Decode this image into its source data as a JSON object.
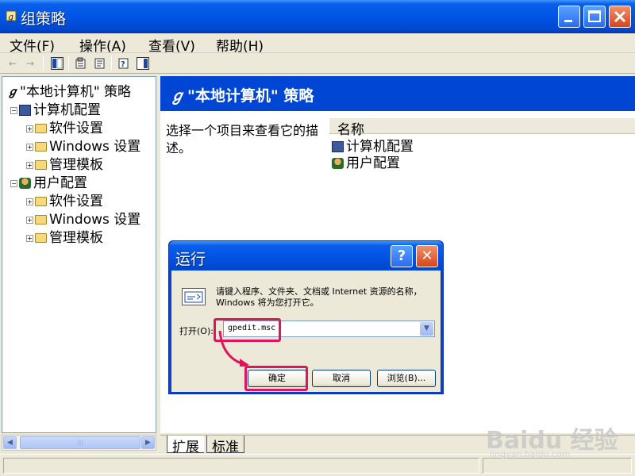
{
  "window": {
    "title": "组策略"
  },
  "menu": [
    "文件(F)",
    "操作(A)",
    "查看(V)",
    "帮助(H)"
  ],
  "toolbar": {
    "back": "←",
    "forward": "→"
  },
  "tree": {
    "root": "\"本地计算机\" 策略",
    "computer_config": "计算机配置",
    "user_config": "用户配置",
    "software_settings": "软件设置",
    "windows_settings": "Windows 设置",
    "admin_templates": "管理模板",
    "collapse_symbol": "−",
    "expand_symbol": "+"
  },
  "right_pane": {
    "header_title": "\"本地计算机\" 策略",
    "description": "选择一个项目来查看它的描述。",
    "column_name": "名称",
    "items": [
      "计算机配置",
      "用户配置"
    ]
  },
  "tabs": [
    "扩展",
    "标准"
  ],
  "run_dialog": {
    "title": "运行",
    "help_symbol": "?",
    "close_symbol": "✕",
    "prompt": "请键入程序、文件夹、文档或 Internet 资源的名称，Windows 将为您打开它。",
    "open_label": "打开(O):",
    "command_value": "gpedit.msc",
    "ok_label": "确定",
    "cancel_label": "取消",
    "browse_label": "浏览(B)...",
    "highlight_color": "#e0155e"
  },
  "watermark": {
    "brand": "Baidu 经验",
    "url": "jingyan.baidu.com"
  }
}
